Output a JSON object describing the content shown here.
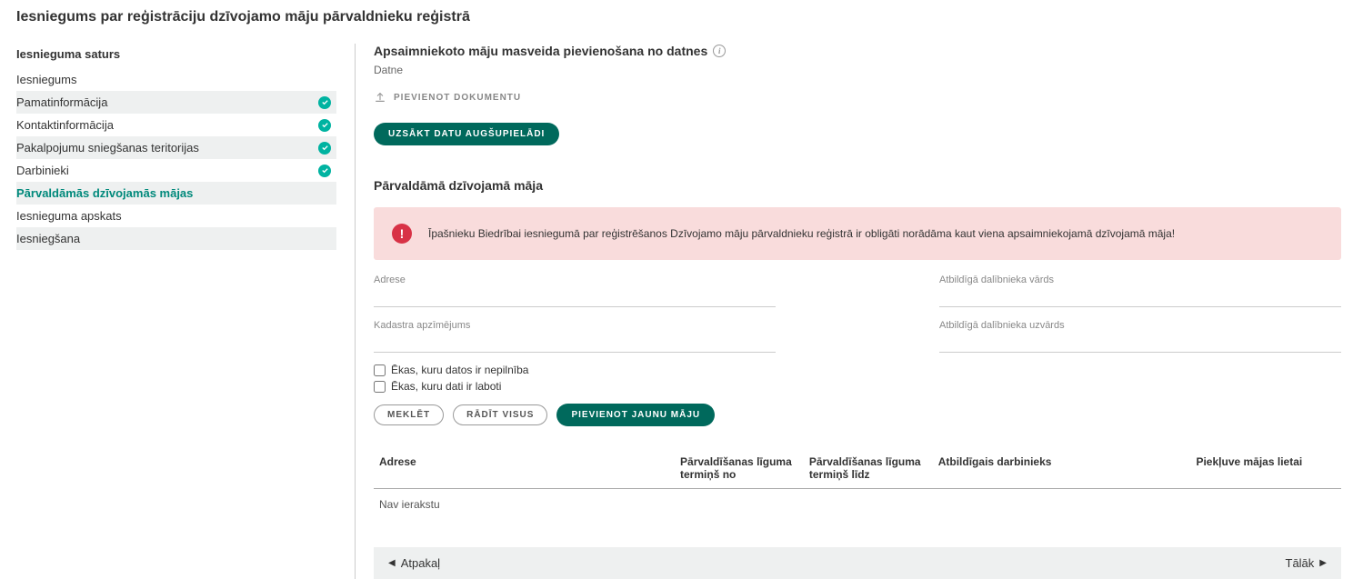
{
  "page_title": "Iesniegums par reģistrāciju dzīvojamo māju pārvaldnieku reģistrā",
  "sidebar": {
    "title": "Iesnieguma saturs",
    "items": [
      {
        "label": "Iesniegums",
        "checked": false,
        "active": false,
        "alt": false
      },
      {
        "label": "Pamatinformācija",
        "checked": true,
        "active": false,
        "alt": true
      },
      {
        "label": "Kontaktinformācija",
        "checked": true,
        "active": false,
        "alt": false
      },
      {
        "label": "Pakalpojumu sniegšanas teritorijas",
        "checked": true,
        "active": false,
        "alt": true
      },
      {
        "label": "Darbinieki",
        "checked": true,
        "active": false,
        "alt": false
      },
      {
        "label": "Pārvaldāmās dzīvojamās mājas",
        "checked": false,
        "active": true,
        "alt": true
      },
      {
        "label": "Iesnieguma apskats",
        "checked": false,
        "active": false,
        "alt": false
      },
      {
        "label": "Iesniegšana",
        "checked": false,
        "active": false,
        "alt": true
      }
    ]
  },
  "upload_section": {
    "title": "Apsaimniekoto māju masveida pievienošana no datnes",
    "file_label": "Datne",
    "attach_label": "PIEVIENOT DOKUMENTU",
    "start_button": "UZSĀKT DATU AUGŠUPIELĀDI"
  },
  "manage_section": {
    "title": "Pārvaldāmā dzīvojamā māja",
    "alert_text": "Īpašnieku Biedrībai iesniegumā par reģistrēšanos Dzīvojamo māju pārvaldnieku reģistrā ir obligāti norādāma kaut viena apsaimniekojamā dzīvojamā māja!",
    "fields": {
      "adrese": "Adrese",
      "atb_vards": "Atbildīgā dalībnieka vārds",
      "kadastrs": "Kadastra apzīmējums",
      "atb_uzvards": "Atbildīgā dalībnieka uzvārds"
    },
    "checkboxes": {
      "cb1": "Ēkas, kuru datos ir nepilnība",
      "cb2": "Ēkas, kuru dati ir laboti"
    },
    "buttons": {
      "search": "MEKLĒT",
      "show_all": "RĀDĪT VISUS",
      "add_new": "PIEVIENOT JAUNU MĀJU"
    }
  },
  "table": {
    "headers": {
      "adrese": "Adrese",
      "term_no": "Pārvaldīšanas līguma termiņš no",
      "term_lidz": "Pārvaldīšanas līguma termiņš līdz",
      "darbinieks": "Atbildīgais darbinieks",
      "piekluve": "Piekļuve mājas lietai"
    },
    "no_records": "Nav ierakstu"
  },
  "nav": {
    "back": "Atpakaļ",
    "next": "Tālāk"
  }
}
